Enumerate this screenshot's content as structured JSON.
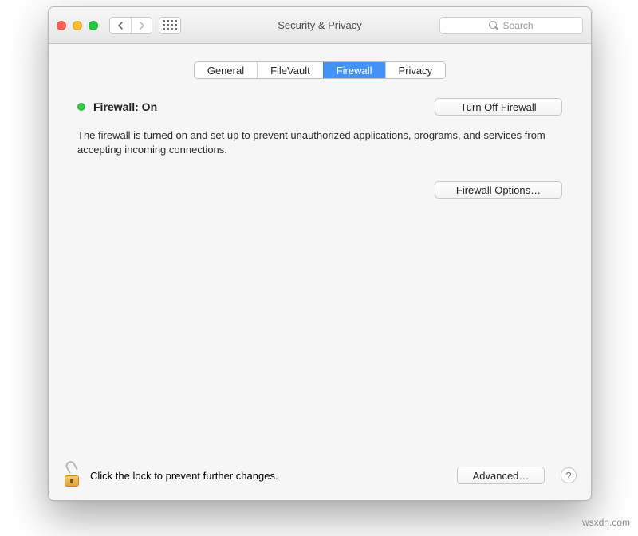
{
  "window": {
    "title": "Security & Privacy"
  },
  "toolbar": {
    "search_placeholder": "Search"
  },
  "tabs": {
    "general": "General",
    "filevault": "FileVault",
    "firewall": "Firewall",
    "privacy": "Privacy",
    "active": "firewall"
  },
  "firewall": {
    "status_label": "Firewall: On",
    "turn_off_label": "Turn Off Firewall",
    "description": "The firewall is turned on and set up to prevent unauthorized applications, programs, and services from accepting incoming connections.",
    "options_label": "Firewall Options…"
  },
  "footer": {
    "lock_hint": "Click the lock to prevent further changes.",
    "advanced_label": "Advanced…",
    "help_label": "?"
  },
  "watermark": "wsxdn.com"
}
